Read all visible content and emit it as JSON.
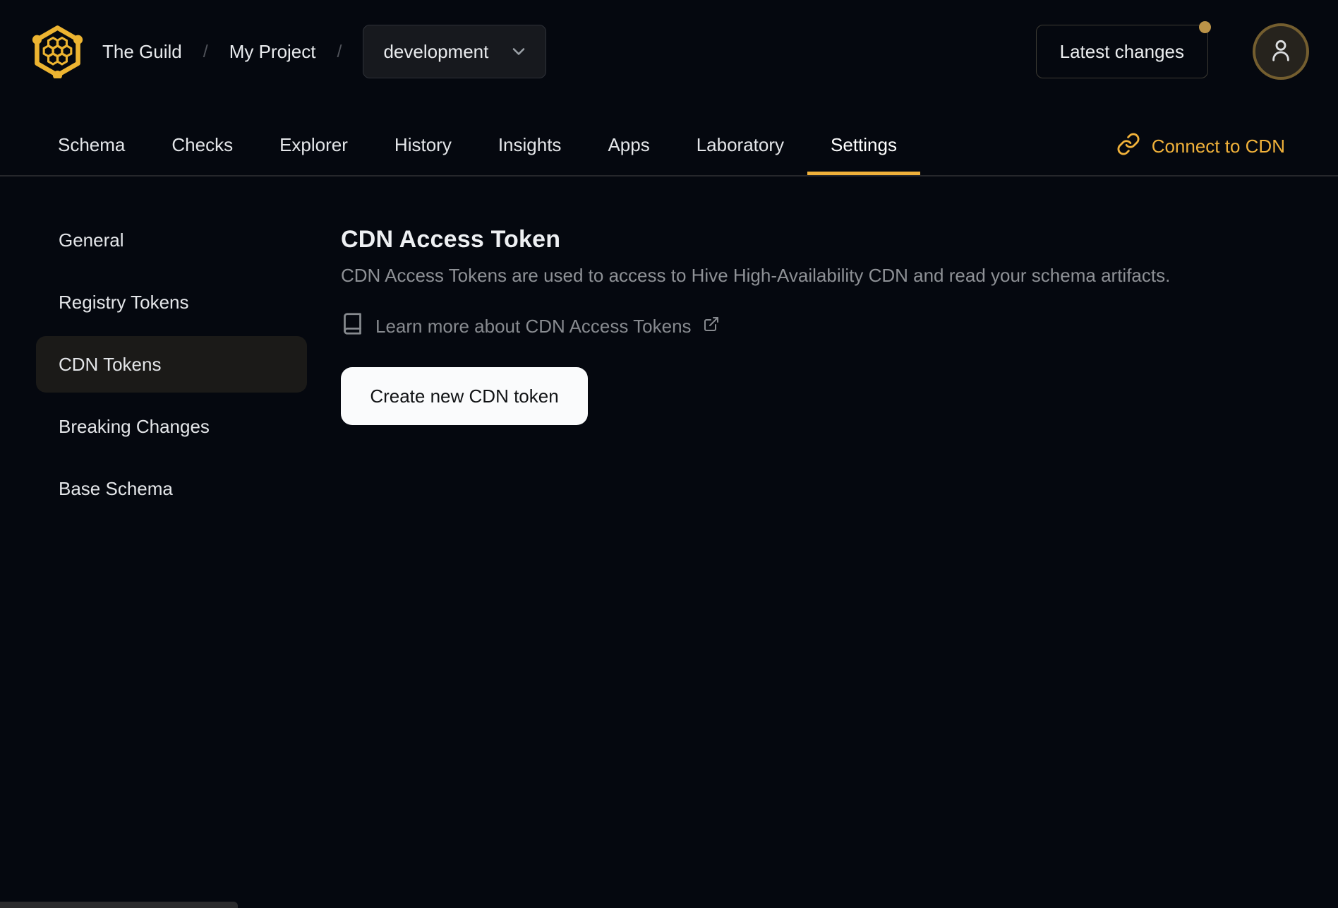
{
  "header": {
    "org": "The Guild",
    "project": "My Project",
    "separator": "/",
    "target_selector": {
      "selected": "development"
    },
    "latest_changes_label": "Latest changes"
  },
  "tabs": {
    "items": [
      {
        "label": "Schema",
        "active": false
      },
      {
        "label": "Checks",
        "active": false
      },
      {
        "label": "Explorer",
        "active": false
      },
      {
        "label": "History",
        "active": false
      },
      {
        "label": "Insights",
        "active": false
      },
      {
        "label": "Apps",
        "active": false
      },
      {
        "label": "Laboratory",
        "active": false
      },
      {
        "label": "Settings",
        "active": true
      }
    ],
    "connect_cdn_label": "Connect to CDN"
  },
  "sidebar": {
    "items": [
      {
        "label": "General",
        "active": false
      },
      {
        "label": "Registry Tokens",
        "active": false
      },
      {
        "label": "CDN Tokens",
        "active": true
      },
      {
        "label": "Breaking Changes",
        "active": false
      },
      {
        "label": "Base Schema",
        "active": false
      }
    ]
  },
  "main": {
    "title": "CDN Access Token",
    "description": "CDN Access Tokens are used to access to Hive High-Availability CDN and read your schema artifacts.",
    "learn_more_label": "Learn more about CDN Access Tokens",
    "create_button_label": "Create new CDN token"
  },
  "icons": {
    "logo": "hive-honeycomb-logo",
    "target_chevron": "chevron-down",
    "notification": "gold-dot",
    "avatar": "user",
    "connect": "chain-link",
    "learn_more": "book",
    "external": "external-link"
  },
  "colors": {
    "background": "#05080f",
    "accent_gold": "#f0b13a",
    "logo_gold": "#edb431",
    "notification_dot": "#bb9348",
    "active_item_bg": "#1b1a18",
    "button_bg": "#fafbfc"
  }
}
